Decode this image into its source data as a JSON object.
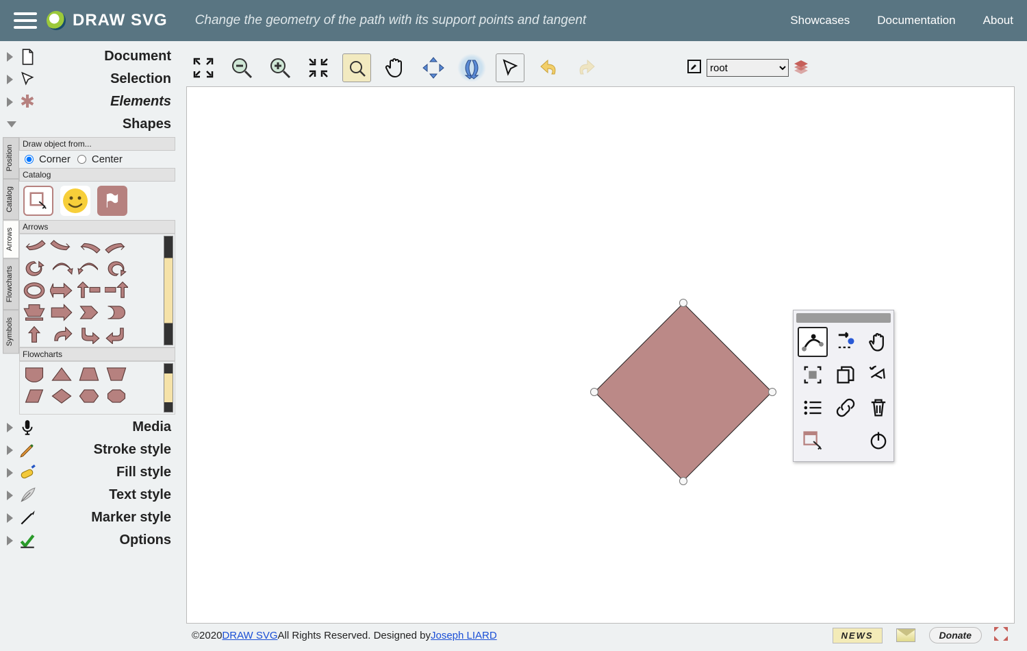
{
  "header": {
    "title": "DRAW SVG",
    "hint": "Change the geometry of the path with its support points and tangent",
    "links": [
      "Showcases",
      "Documentation",
      "About"
    ]
  },
  "sidebar": {
    "items": [
      {
        "label": "Document",
        "icon": "doc"
      },
      {
        "label": "Selection",
        "icon": "pointer"
      },
      {
        "label": "Elements",
        "icon": "asterisk",
        "italic": true
      },
      {
        "label": "Shapes",
        "icon": "",
        "open": true
      }
    ],
    "shapes": {
      "draw_from_label": "Draw object from...",
      "corner": "Corner",
      "center": "Center",
      "catalog_label": "Catalog",
      "arrows_label": "Arrows",
      "flow_label": "Flowcharts",
      "vtabs": [
        "Position",
        "Catalog",
        "Arrows",
        "Flowcharts",
        "Symbols"
      ]
    },
    "items2": [
      {
        "label": "Media",
        "icon": "mic"
      },
      {
        "label": "Stroke style",
        "icon": "pencil"
      },
      {
        "label": "Fill style",
        "icon": "roller"
      },
      {
        "label": "Text style",
        "icon": "feather"
      },
      {
        "label": "Marker style",
        "icon": "marker"
      },
      {
        "label": "Options",
        "icon": "check"
      }
    ]
  },
  "toolbar": {
    "root_select": "root"
  },
  "footer": {
    "copyright": "©2020 ",
    "link1": "DRAW SVG",
    "mid": " All Rights Reserved. Designed by ",
    "link2": "Joseph LIARD",
    "news": "NEWS",
    "donate": "Donate"
  }
}
